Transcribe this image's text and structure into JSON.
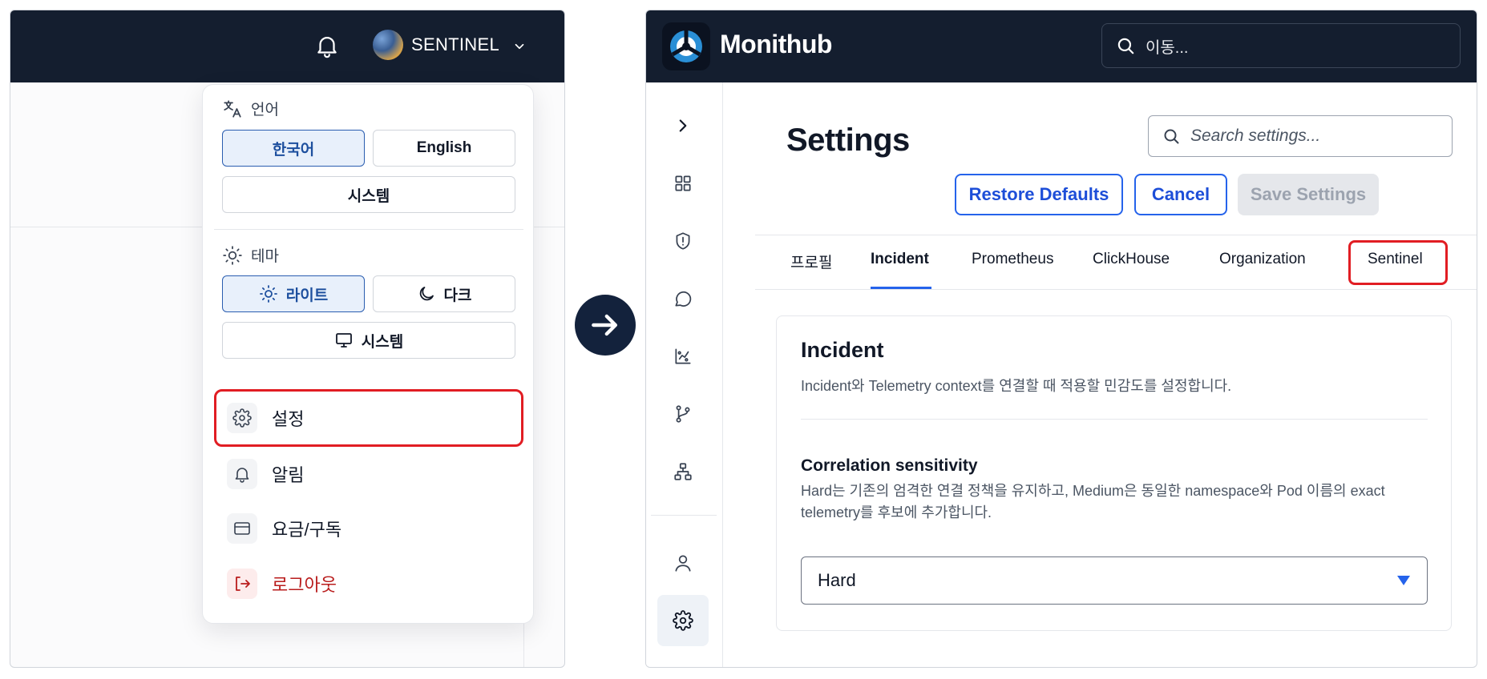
{
  "left": {
    "user_name": "SENTINEL",
    "dropdown": {
      "language": {
        "heading": "언어",
        "options": [
          "한국어",
          "English",
          "시스템"
        ],
        "selected": "한국어"
      },
      "theme": {
        "heading": "테마",
        "options": [
          "라이트",
          "다크",
          "시스템"
        ],
        "selected": "라이트"
      },
      "menu": [
        {
          "label": "설정",
          "icon": "gear-icon",
          "highlighted": true
        },
        {
          "label": "알림",
          "icon": "bell-icon"
        },
        {
          "label": "요금/구독",
          "icon": "credit-card-icon"
        },
        {
          "label": "로그아웃",
          "icon": "logout-icon",
          "danger": true
        }
      ]
    }
  },
  "right": {
    "brand": "Monithub",
    "global_search_placeholder": "이동...",
    "nav_icons": [
      "chevron-right-icon",
      "dashboard-grid-icon",
      "shield-alert-icon",
      "chat-icon",
      "chart-icon",
      "git-branch-icon",
      "network-icon",
      "user-icon",
      "gear-icon"
    ],
    "page_title": "Settings",
    "settings_search_placeholder": "Search settings...",
    "buttons": {
      "restore": "Restore Defaults",
      "cancel": "Cancel",
      "save": "Save Settings"
    },
    "tabs": [
      "프로필",
      "Incident",
      "Prometheus",
      "ClickHouse",
      "Organization",
      "Sentinel"
    ],
    "active_tab": "Incident",
    "card": {
      "title": "Incident",
      "description": "Incident와 Telemetry context를 연결할 때 적용할 민감도를 설정합니다.",
      "field_label": "Correlation sensitivity",
      "field_help": "Hard는 기존의 엄격한 연결 정책을 유지하고, Medium은 동일한 namespace와 Pod 이름의 exact telemetry를 후보에 추가합니다.",
      "select_value": "Hard"
    }
  },
  "colors": {
    "topbar": "#141e2f",
    "accent": "#2563eb",
    "highlight": "#e11d23",
    "danger": "#b91c1c"
  }
}
